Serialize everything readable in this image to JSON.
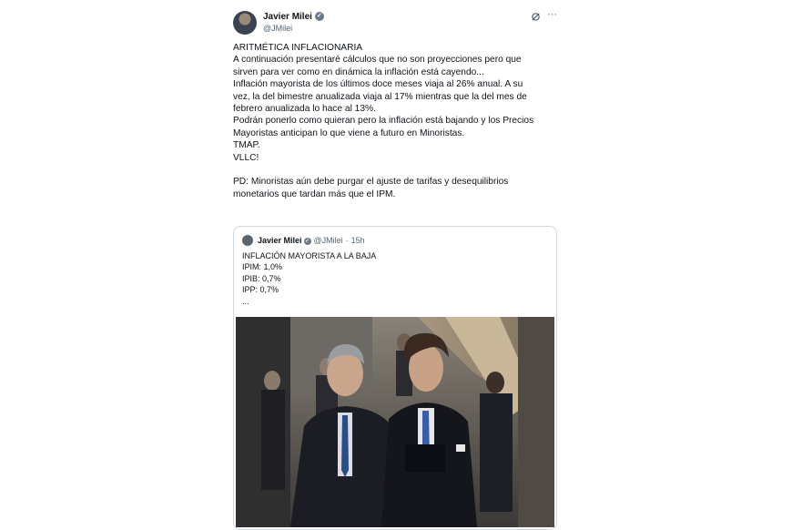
{
  "tweet": {
    "author_name": "Javier Milei",
    "handle": "@JMilei",
    "verified_icon": "verified-badge-icon",
    "header_icons": [
      "grok-icon",
      "more-icon"
    ],
    "more_label": "···",
    "text_lines": [
      "ARITMÉTICA INFLACIONARIA",
      "A continuación presentaré cálculos que no son proyecciones pero que",
      "sirven para ver como en dinámica la inflación está cayendo...",
      "Inflación mayorista de los últimos doce meses viaja al 26% anual.  A su",
      "vez, la del bimestre anualizada viaja al 17% mientras que la del mes de",
      "febrero anualizada lo hace al 13%.",
      "Podrán ponerlo como quieran pero la inflación está bajando y los Precios",
      "Mayoristas anticipan lo que viene a futuro en Minoristas.",
      "TMAP.",
      "VLLC!",
      "",
      "PD: Minoristas aún debe purgar el ajuste de tarifas y desequilibrios",
      "monetarios que tardan más que el IPM."
    ]
  },
  "quote": {
    "author_name": "Javier Milei",
    "handle": "@JMilei",
    "separator": "·",
    "time": "15h",
    "text_lines": [
      "INFLACIÓN MAYORISTA A LA BAJA",
      "IPIM: 1,0%",
      "IPIB: 0,7%",
      "IPP: 0,7%",
      "..."
    ],
    "image_icon": "photo-two-men-escalator"
  },
  "colors": {
    "text": "#0f1419",
    "secondary": "#536471",
    "border": "#cfd9de",
    "background": "#ffffff"
  }
}
